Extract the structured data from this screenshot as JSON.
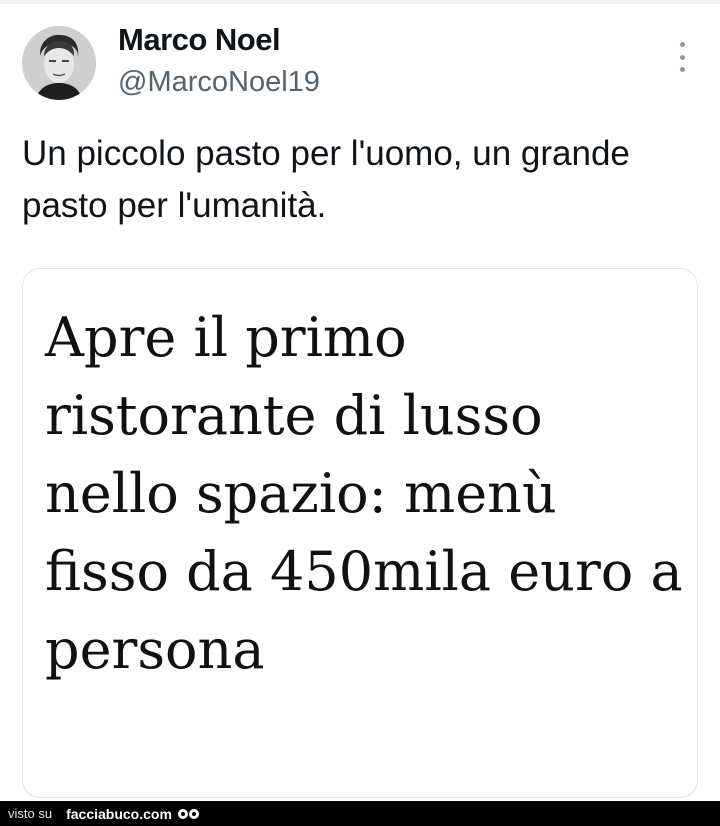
{
  "tweet": {
    "display_name": "Marco Noel",
    "handle": "@MarcoNoel19",
    "text": "Un piccolo pasto per l'uomo, un grande pasto per l'umanità.",
    "avatar_icon": "user-avatar-photo",
    "more_icon": "vertical-ellipsis-icon"
  },
  "card": {
    "headline": "Apre il primo ristorante di lusso nello spazio: menù fisso da 450mila euro a persona"
  },
  "watermark": {
    "prefix": "visto su",
    "site": "facciabuco.com"
  }
}
